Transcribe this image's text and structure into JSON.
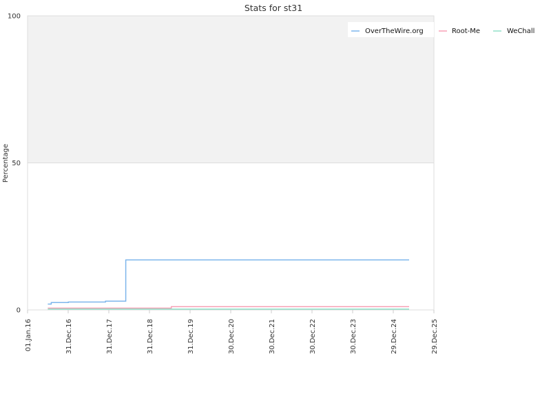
{
  "chart_data": {
    "type": "line",
    "step": true,
    "title": "Stats for st31",
    "xlabel": "",
    "ylabel": "Percentage",
    "xlim": [
      "2016-01-01",
      "2025-12-29"
    ],
    "ylim": [
      0,
      100
    ],
    "x_ticks": [
      {
        "date": "2016-01-01",
        "label": "01.Jan.16"
      },
      {
        "date": "2016-12-31",
        "label": "31.Dec.16"
      },
      {
        "date": "2017-12-31",
        "label": "31.Dec.17"
      },
      {
        "date": "2018-12-31",
        "label": "31.Dec.18"
      },
      {
        "date": "2019-12-31",
        "label": "31.Dec.19"
      },
      {
        "date": "2020-12-30",
        "label": "30.Dec.20"
      },
      {
        "date": "2021-12-30",
        "label": "30.Dec.21"
      },
      {
        "date": "2022-12-30",
        "label": "30.Dec.22"
      },
      {
        "date": "2023-12-30",
        "label": "30.Dec.23"
      },
      {
        "date": "2024-12-29",
        "label": "29.Dec.24"
      },
      {
        "date": "2025-12-29",
        "label": "29.Dec.25"
      }
    ],
    "y_ticks": [
      {
        "value": 0,
        "label": "0"
      },
      {
        "value": 50,
        "label": "50"
      },
      {
        "value": 100,
        "label": "100"
      }
    ],
    "grid": true,
    "legend_position": "top-right",
    "series": [
      {
        "name": "OverTheWire.org",
        "color": "#7cb5ec",
        "points": [
          {
            "x": "2016-07-01",
            "y": 2.0
          },
          {
            "x": "2016-08-01",
            "y": 2.5
          },
          {
            "x": "2017-01-01",
            "y": 2.7
          },
          {
            "x": "2017-12-01",
            "y": 3.0
          },
          {
            "x": "2018-06-01",
            "y": 17.0
          },
          {
            "x": "2025-05-20",
            "y": 17.0
          }
        ]
      },
      {
        "name": "Root-Me",
        "color": "#f7a1b5",
        "points": [
          {
            "x": "2016-07-01",
            "y": 0.6
          },
          {
            "x": "2019-07-15",
            "y": 1.1
          },
          {
            "x": "2025-05-20",
            "y": 1.1
          }
        ]
      },
      {
        "name": "WeChall",
        "color": "#90e0c8",
        "points": [
          {
            "x": "2016-07-01",
            "y": 0.3
          },
          {
            "x": "2025-05-20",
            "y": 0.3
          }
        ]
      }
    ]
  }
}
